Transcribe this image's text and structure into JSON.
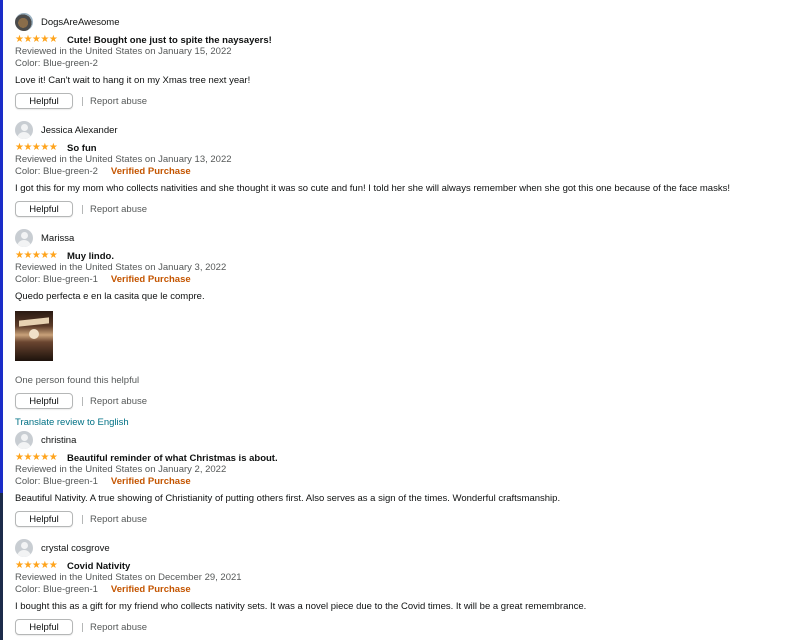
{
  "reviews": [
    {
      "name": "DogsAreAwesome",
      "stars": "★★★★★",
      "title": "Cute! Bought one just to spite the naysayers!",
      "date": "Reviewed in the United States on January 15, 2022",
      "color": "Color: Blue-green-2",
      "verified": "",
      "text": "Love it! Can't wait to hang it on my Xmas tree next year!",
      "helpful": "Helpful",
      "report": "Report abuse"
    },
    {
      "name": "Jessica Alexander",
      "stars": "★★★★★",
      "title": "So fun",
      "date": "Reviewed in the United States on January 13, 2022",
      "color": "Color: Blue-green-2",
      "verified": "Verified Purchase",
      "text": "I got this for my mom who collects nativities and she thought it was so cute and fun! I told her she will always remember when she got this one because of the face masks!",
      "helpful": "Helpful",
      "report": "Report abuse"
    },
    {
      "name": "Marissa",
      "stars": "★★★★★",
      "title": "Muy lindo.",
      "date": "Reviewed in the United States on January 3, 2022",
      "color": "Color: Blue-green-1",
      "verified": "Verified Purchase",
      "text": "Quedo perfecta e en la casita que le compre.",
      "found": "One person found this helpful",
      "helpful": "Helpful",
      "report": "Report abuse",
      "translate": "Translate review to English"
    },
    {
      "name": "christina",
      "stars": "★★★★★",
      "title": "Beautiful reminder of what Christmas is about.",
      "date": "Reviewed in the United States on January 2, 2022",
      "color": "Color: Blue-green-1",
      "verified": "Verified Purchase",
      "text": "Beautiful Nativity. A true showing of Christianity of putting others first. Also serves as a sign of the times. Wonderful craftsmanship.",
      "helpful": "Helpful",
      "report": "Report abuse"
    },
    {
      "name": "crystal cosgrove",
      "stars": "★★★★★",
      "title": "Covid Nativity",
      "date": "Reviewed in the United States on December 29, 2021",
      "color": "Color: Blue-green-1",
      "verified": "Verified Purchase",
      "text": "I bought this as a gift for my friend who collects nativity sets. It was a novel piece due to the Covid times. It will be a great remembrance.",
      "helpful": "Helpful",
      "report": "Report abuse"
    }
  ],
  "colors": {
    "star": "#ffa41c",
    "verified": "#c45500",
    "link": "#007185",
    "muted": "#565959"
  }
}
